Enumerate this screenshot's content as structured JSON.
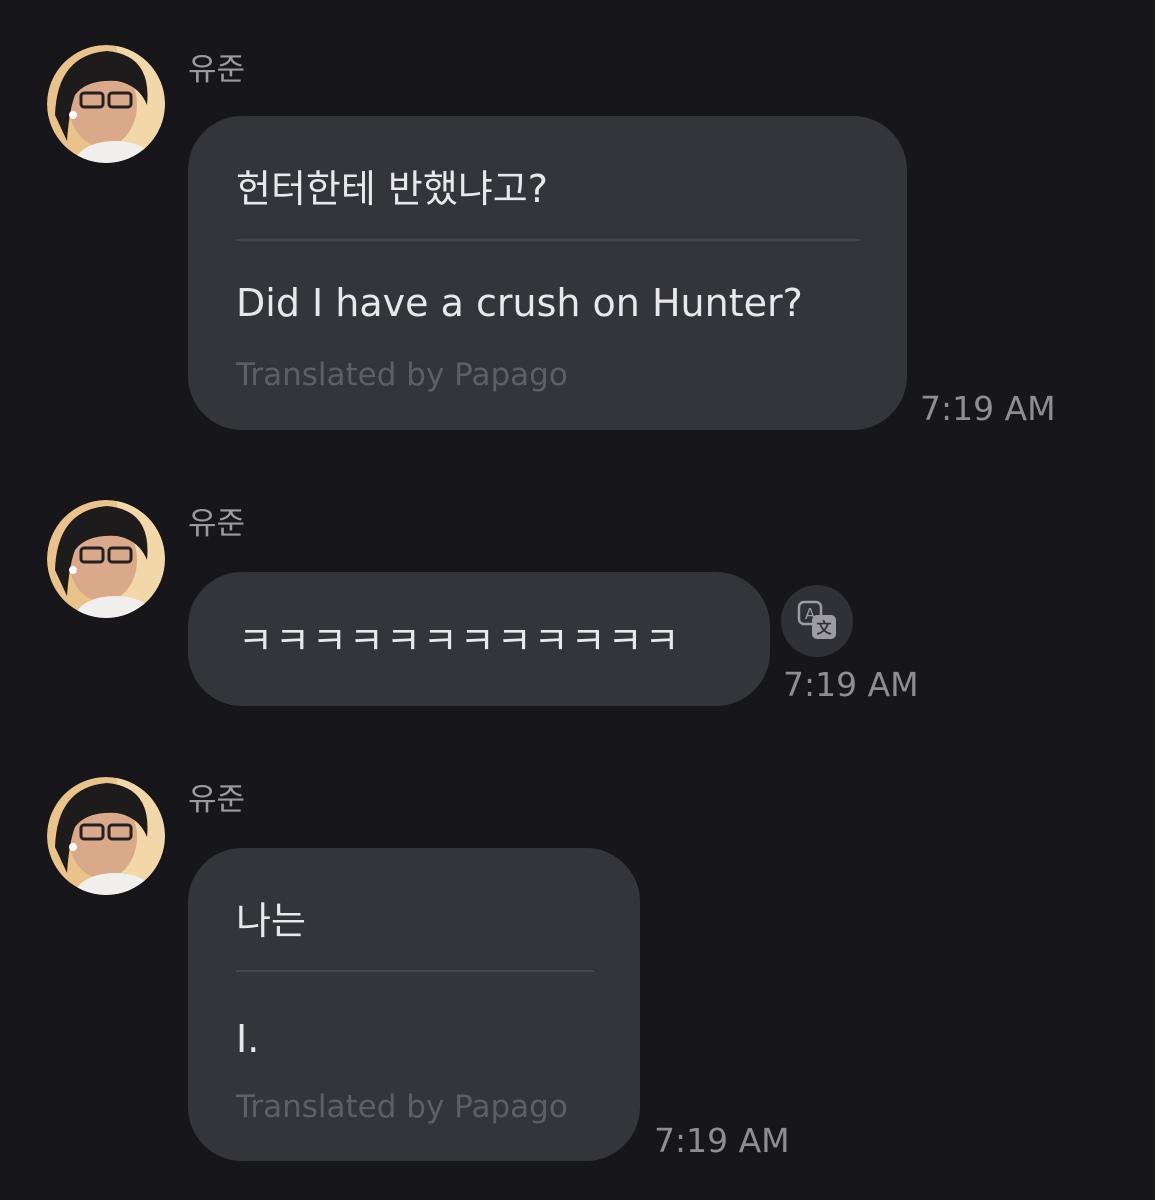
{
  "messages": [
    {
      "sender": "유준",
      "original": "헌터한테 반했냐고?",
      "translation": "Did I have a crush on Hunter?",
      "credit": "Translated by Papago",
      "time": "7:19 AM"
    },
    {
      "sender": "유준",
      "original": "ㅋㅋㅋㅋㅋㅋㅋㅋㅋㅋㅋㅋ",
      "time": "7:19 AM",
      "translate_icon": "translate-icon"
    },
    {
      "sender": "유준",
      "original": "나는",
      "translation": "I.",
      "credit": "Translated by Papago",
      "time": "7:19 AM"
    }
  ],
  "colors": {
    "background": "#17171b",
    "bubble": "#33353b",
    "muted_text": "#8d8d93"
  }
}
